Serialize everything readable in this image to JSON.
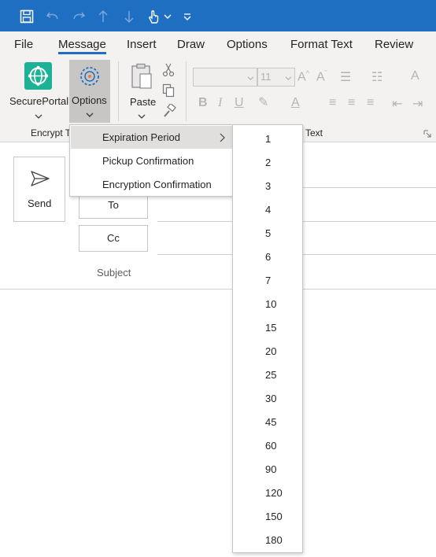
{
  "quick_access": {
    "icons": [
      "save-icon",
      "undo-icon",
      "redo-icon",
      "up-arrow-icon",
      "down-arrow-icon",
      "touch-mode-icon",
      "customize-icon"
    ]
  },
  "tabs": [
    {
      "label": "File",
      "active": false
    },
    {
      "label": "Message",
      "active": true
    },
    {
      "label": "Insert",
      "active": false
    },
    {
      "label": "Draw",
      "active": false
    },
    {
      "label": "Options",
      "active": false
    },
    {
      "label": "Format Text",
      "active": false
    },
    {
      "label": "Review",
      "active": false
    }
  ],
  "ribbon": {
    "secureportal_label": "SecurePortal",
    "options_label": "Options",
    "paste_label": "Paste",
    "font_size": "11",
    "group_encrypt": "Encrypt T",
    "group_text": "Text"
  },
  "compose": {
    "send_label": "Send",
    "to_label": "To",
    "cc_label": "Cc",
    "subject_label": "Subject"
  },
  "options_menu": {
    "items": [
      "Expiration Period",
      "Pickup Confirmation",
      "Encryption Confirmation"
    ]
  },
  "expiration_submenu": {
    "values": [
      "1",
      "2",
      "3",
      "4",
      "5",
      "6",
      "7",
      "10",
      "15",
      "20",
      "25",
      "30",
      "45",
      "60",
      "90",
      "120",
      "150",
      "180"
    ]
  },
  "colors": {
    "titlebar": "#1e6fc2",
    "ribbon_bg": "#f3f2f1",
    "accent": "#1e6fc2",
    "secureportal_icon": "#1bb295",
    "highlight": "#e1dfdd"
  }
}
